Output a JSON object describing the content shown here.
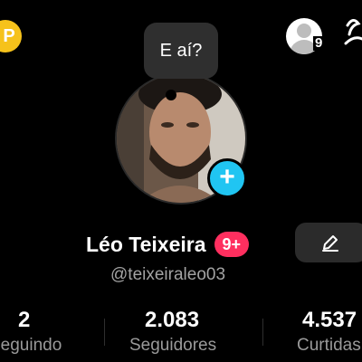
{
  "header": {
    "coin_icon": "coin-p-icon",
    "coin_letter": "P",
    "coin_color": "#f6c21b",
    "friends_icon": "person-avatar-icon",
    "friends_count": "9"
  },
  "profile": {
    "speech_bubble": "E aí?",
    "avatar": "profile-photo",
    "add_icon": "plus-icon",
    "add_color": "#20c5f2",
    "name": "Léo Teixeira",
    "notification_badge": "9+",
    "badge_color": "#ff2f5f",
    "edit_icon": "pencil-icon",
    "username": "@teixeiraleo03"
  },
  "stats": [
    {
      "value": "2",
      "label": "Seguindo"
    },
    {
      "value": "2.083",
      "label": "Seguidores"
    },
    {
      "value": "4.537",
      "label": "Curtidas"
    }
  ]
}
